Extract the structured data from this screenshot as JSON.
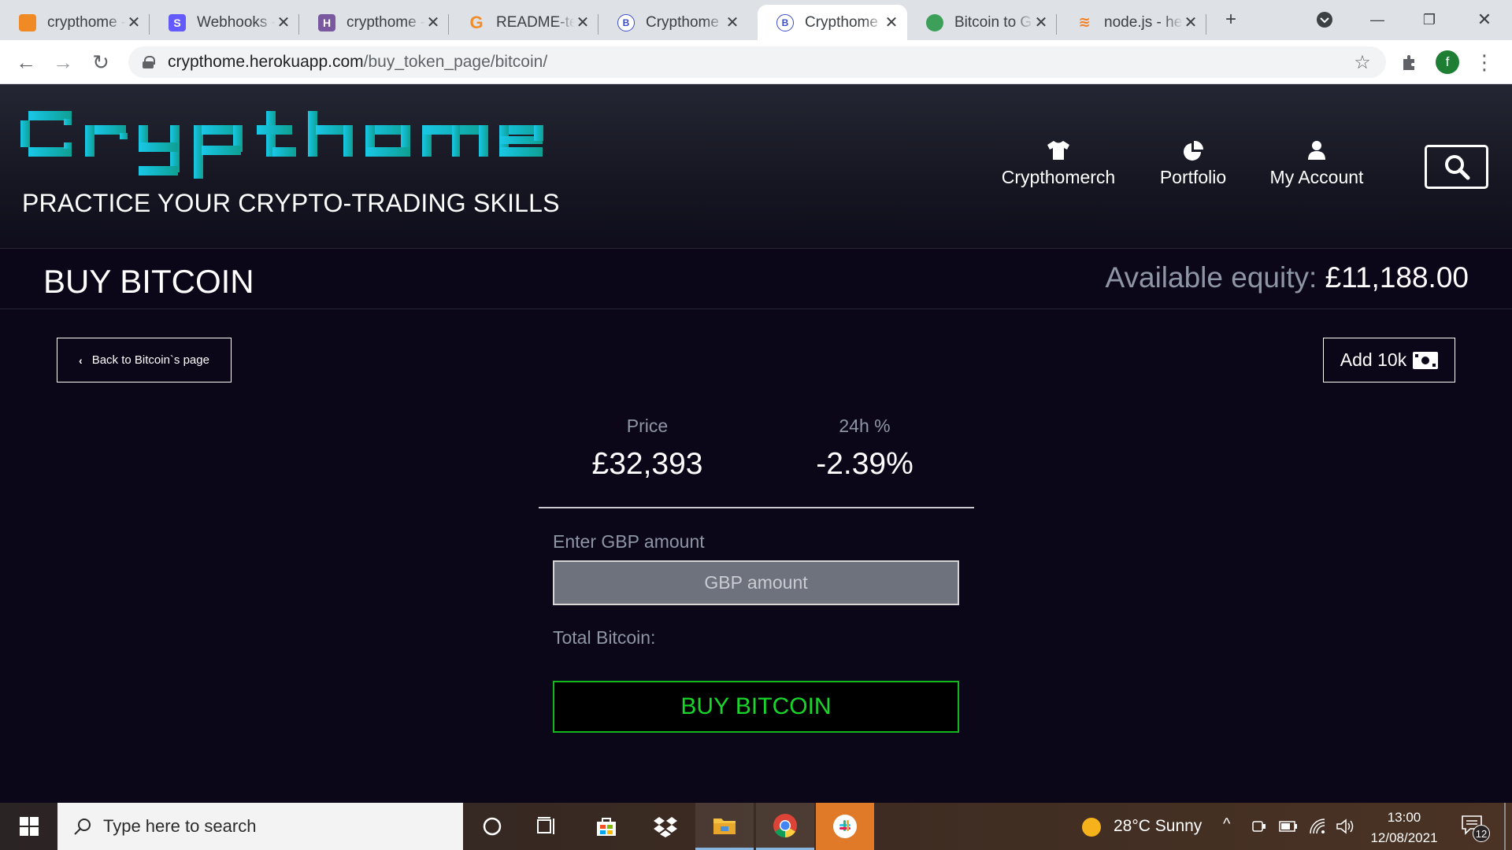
{
  "browser": {
    "tabs": [
      {
        "title": "crypthome - ",
        "favicon": "box-icon",
        "color": "#f08a24"
      },
      {
        "title": "Webhooks - ",
        "favicon": "stripe-icon",
        "color": "#635bff"
      },
      {
        "title": "crypthome - ",
        "favicon": "heroku-icon",
        "color": "#79589f"
      },
      {
        "title": "README-te",
        "favicon": "gitpod-icon",
        "color": "#f28c28"
      },
      {
        "title": "Crypthome",
        "favicon": "bitcoin-b-icon",
        "color": "#3b4dc8"
      },
      {
        "title": "Crypthome",
        "favicon": "bitcoin-b-icon",
        "color": "#3b4dc8",
        "active": true
      },
      {
        "title": "Bitcoin to G",
        "favicon": "coin-icon",
        "color": "#3ca05a"
      },
      {
        "title": "node.js - he",
        "favicon": "stackoverflow-icon",
        "color": "#f48024"
      }
    ],
    "url_host": "crypthome.herokuapp.com",
    "url_path": "/buy_token_page/bitcoin/",
    "profile_initial": "f"
  },
  "header": {
    "logo_text": "Crypthome",
    "tagline": "PRACTICE YOUR CRYPTO-TRADING SKILLS",
    "nav": [
      {
        "label": "Crypthomerch",
        "icon": "tshirt-icon"
      },
      {
        "label": "Portfolio",
        "icon": "pie-chart-icon"
      },
      {
        "label": "My Account",
        "icon": "user-icon"
      }
    ]
  },
  "page": {
    "title": "BUY BITCOIN",
    "equity_label": "Available equity: ",
    "equity_value": "£11,188.00",
    "back_label": "Back to Bitcoin`s page",
    "add_label": "Add 10k",
    "price_label": "Price",
    "price_value": "£32,393",
    "change_label": "24h %",
    "change_value": "-2.39%",
    "gbp_label": "Enter GBP amount",
    "gbp_placeholder": "GBP amount",
    "total_label": "Total Bitcoin:",
    "buy_label": "BUY BITCOIN"
  },
  "taskbar": {
    "search_placeholder": "Type here to search",
    "weather": "28°C  Sunny",
    "time": "13:00",
    "date": "12/08/2021",
    "notifications": "12"
  },
  "colors": {
    "logo_cyan": "#16c4d8",
    "logo_teal": "#12a69a",
    "buy_green": "#18d62a",
    "background": "#0b0719"
  }
}
